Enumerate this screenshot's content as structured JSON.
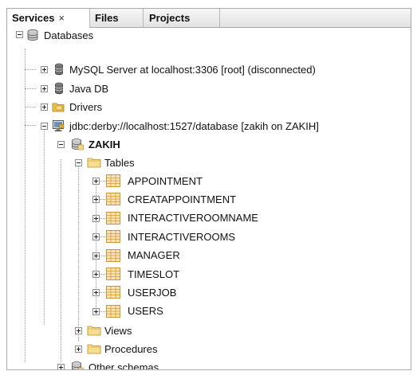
{
  "tabs": [
    {
      "label": "Services",
      "close": "×"
    },
    {
      "label": "Files"
    },
    {
      "label": "Projects"
    }
  ],
  "tree": {
    "databases": "Databases",
    "mysql": "MySQL Server at localhost:3306 [root] (disconnected)",
    "javadb": "Java DB",
    "drivers": "Drivers",
    "connection": "jdbc:derby://localhost:1527/database [zakih on ZAKIH]",
    "schema": "ZAKIH",
    "tables": "Tables",
    "table_items": [
      "APPOINTMENT",
      "CREATAPPOINTMENT",
      "INTERACTIVEROOMNAME",
      "INTERACTIVEROOMS",
      "MANAGER",
      "TIMESLOT",
      "USERJOB",
      "USERS"
    ],
    "views": "Views",
    "procedures": "Procedures",
    "other_schemas": "Other schemas"
  },
  "icons": {
    "databases": "database-icon",
    "mysql": "mysql-server-icon",
    "javadb": "javadb-icon",
    "drivers": "drivers-icon",
    "connection": "connection-icon",
    "schema": "schema-icon",
    "folder": "folder-icon",
    "table": "table-icon"
  }
}
